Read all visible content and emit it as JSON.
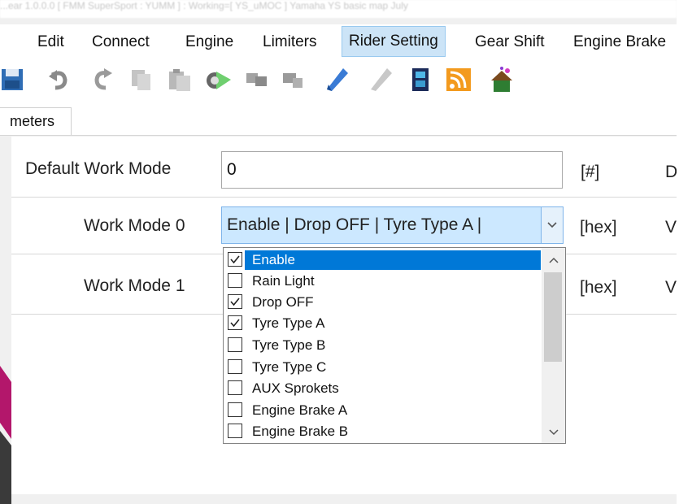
{
  "window": {
    "title_fragment": "...ear 1.0.0.0 [ FMM SuperSport : YUMM ] : Working=[ YS_uMOC ] Yamaha YS basic map July"
  },
  "menu": {
    "items": [
      {
        "label": "Edit"
      },
      {
        "label": "Connect"
      },
      {
        "label": "Engine"
      },
      {
        "label": "Limiters"
      },
      {
        "label": "Rider Setting"
      },
      {
        "label": "Gear Shift"
      },
      {
        "label": "Engine Brake"
      }
    ]
  },
  "toolbar": {
    "icons": [
      "save-icon",
      "undo-icon",
      "redo-icon",
      "copy-icon",
      "paste-icon",
      "connect-icon",
      "disconnect-icon",
      "disconnect-alt-icon",
      "flash-pen-icon",
      "flash-pen-disabled-icon",
      "film-icon",
      "rss-icon",
      "house-icon"
    ]
  },
  "tabs": [
    {
      "label": "meters"
    }
  ],
  "form": {
    "default_work_mode": {
      "label": "Default Work Mode",
      "value": "0",
      "unit": "[#]",
      "trailing": "D"
    },
    "work_mode_0": {
      "label": "Work Mode 0",
      "value": "Enable | Drop OFF | Tyre Type A |",
      "unit": "[hex]",
      "trailing": "V"
    },
    "work_mode_1": {
      "label": "Work Mode 1",
      "unit": "[hex]",
      "trailing": "V"
    }
  },
  "dropdown": {
    "options": [
      {
        "label": "Enable",
        "checked": true,
        "selected": true
      },
      {
        "label": "Rain Light",
        "checked": false
      },
      {
        "label": "Drop OFF",
        "checked": true
      },
      {
        "label": "Tyre Type A",
        "checked": true
      },
      {
        "label": "Tyre Type B",
        "checked": false
      },
      {
        "label": "Tyre Type C",
        "checked": false
      },
      {
        "label": "AUX Sprokets",
        "checked": false
      },
      {
        "label": "Engine Brake A",
        "checked": false
      },
      {
        "label": "Engine Brake B",
        "checked": false
      }
    ]
  },
  "colors": {
    "selection": "#0078d7",
    "combo_highlight": "#cce8ff",
    "decor_magenta": "#b3176b",
    "decor_dark": "#3a3a3a"
  }
}
